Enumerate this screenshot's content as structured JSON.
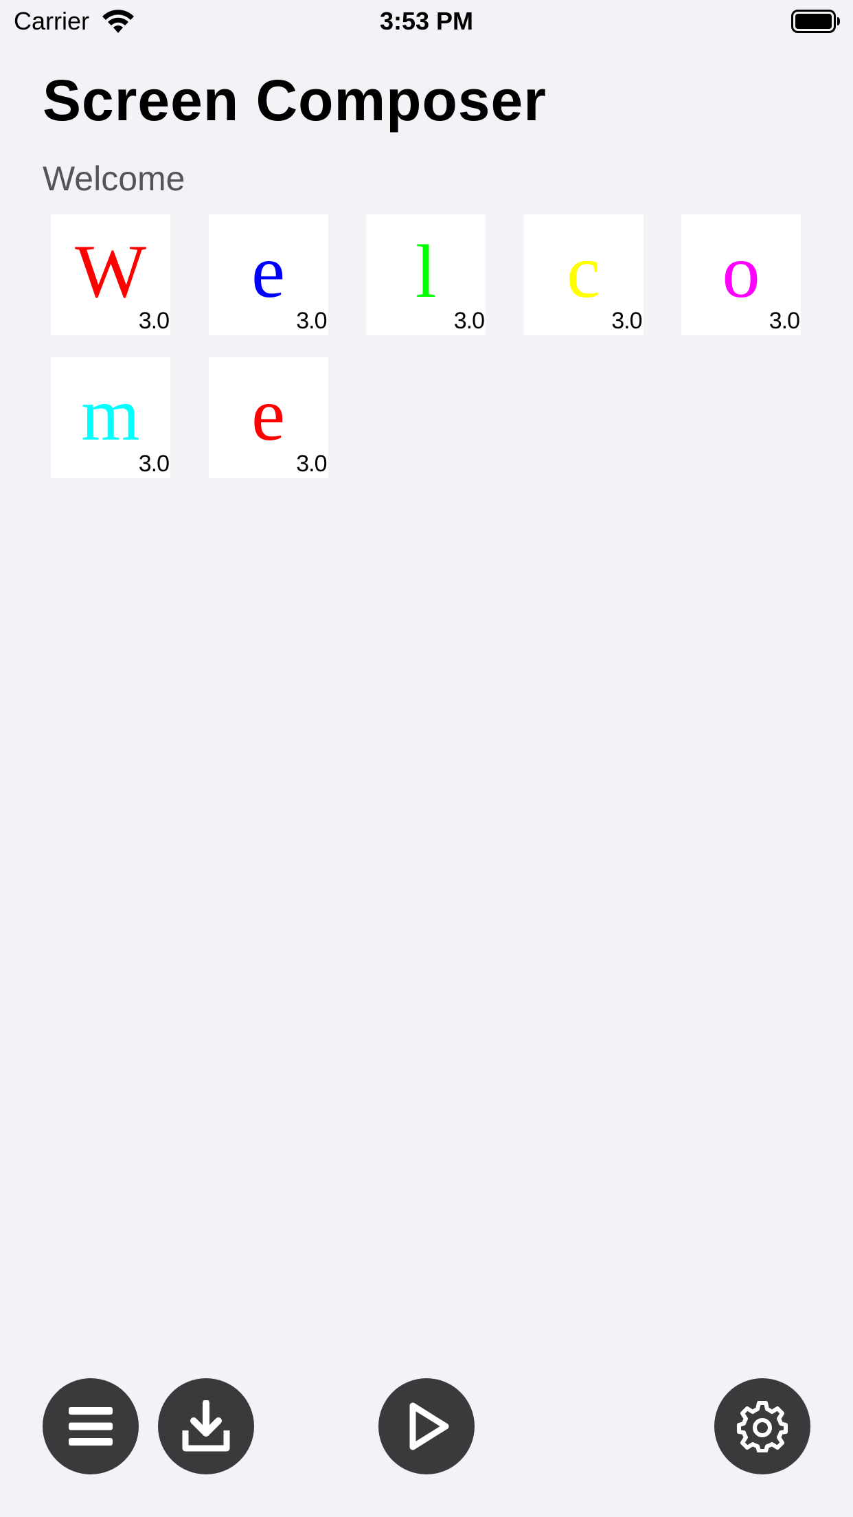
{
  "status_bar": {
    "carrier": "Carrier",
    "time": "3:53 PM"
  },
  "app": {
    "title": "Screen Composer",
    "subtitle": "Welcome"
  },
  "tiles": [
    {
      "letter": "W",
      "color": "#ff0000",
      "duration": "3.0"
    },
    {
      "letter": "e",
      "color": "#0000ff",
      "duration": "3.0"
    },
    {
      "letter": "l",
      "color": "#00ff00",
      "duration": "3.0"
    },
    {
      "letter": "c",
      "color": "#ffff00",
      "duration": "3.0"
    },
    {
      "letter": "o",
      "color": "#ff00ff",
      "duration": "3.0"
    },
    {
      "letter": "m",
      "color": "#00ffff",
      "duration": "3.0"
    },
    {
      "letter": "e",
      "color": "#ff0000",
      "duration": "3.0"
    }
  ],
  "toolbar": {
    "buttons": [
      {
        "icon": "menu-icon"
      },
      {
        "icon": "download-icon"
      },
      {
        "icon": "play-icon"
      },
      {
        "icon": "gear-icon"
      }
    ],
    "button_color": "#3a3a3c",
    "icon_color": "#ffffff"
  },
  "colors": {
    "background": "#f2f2f7",
    "tile_background": "#ffffff",
    "subtitle": "#555558"
  }
}
